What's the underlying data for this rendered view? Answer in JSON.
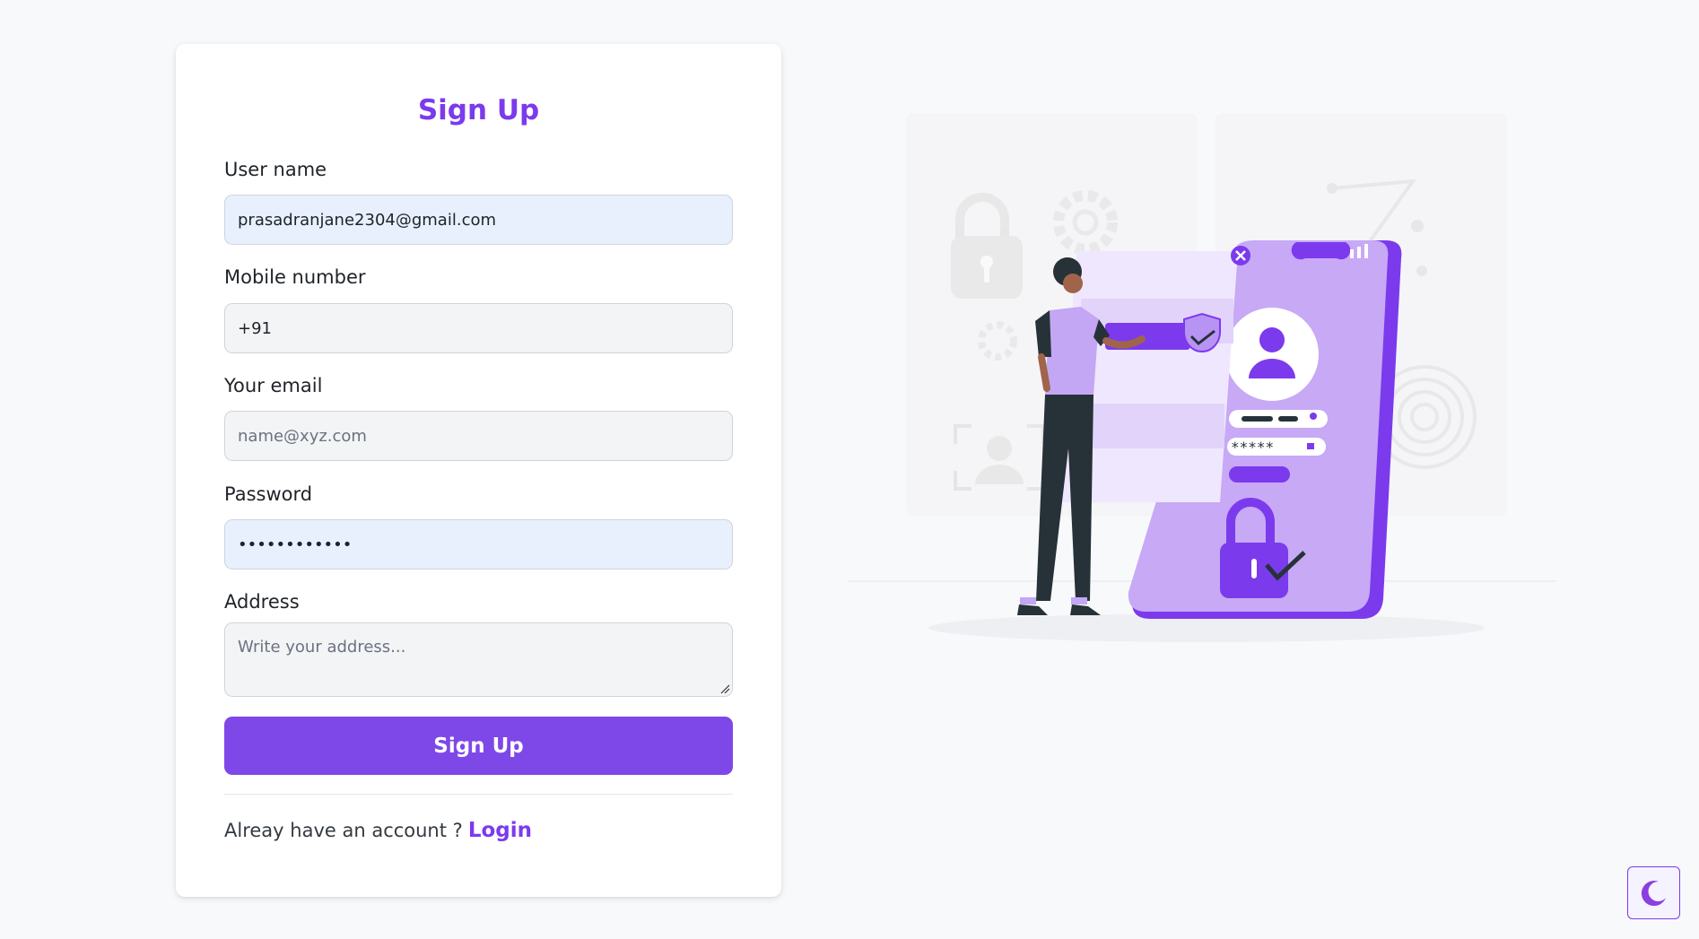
{
  "form": {
    "title": "Sign Up",
    "username": {
      "label": "User name",
      "value": "prasadranjane2304@gmail.com"
    },
    "mobile": {
      "label": "Mobile number",
      "value": "+91"
    },
    "email": {
      "label": "Your email",
      "placeholder": "name@xyz.com"
    },
    "password": {
      "label": "Password",
      "value": "••••••••••••"
    },
    "address": {
      "label": "Address",
      "placeholder": "Write your address..."
    },
    "submit_label": "Sign Up",
    "footer_text": "Alreay have an account ?",
    "login_link": "Login"
  },
  "illustration": {
    "name": "mobile-login-security-illustration",
    "password_mask": "*****"
  },
  "theme_toggle": {
    "icon": "moon-icon"
  },
  "colors": {
    "accent": "#7c3aed",
    "button": "#7e48e8",
    "autofill_bg": "#e8f0fe",
    "input_bg": "#f3f4f6",
    "page_bg": "#f8f9fb"
  }
}
